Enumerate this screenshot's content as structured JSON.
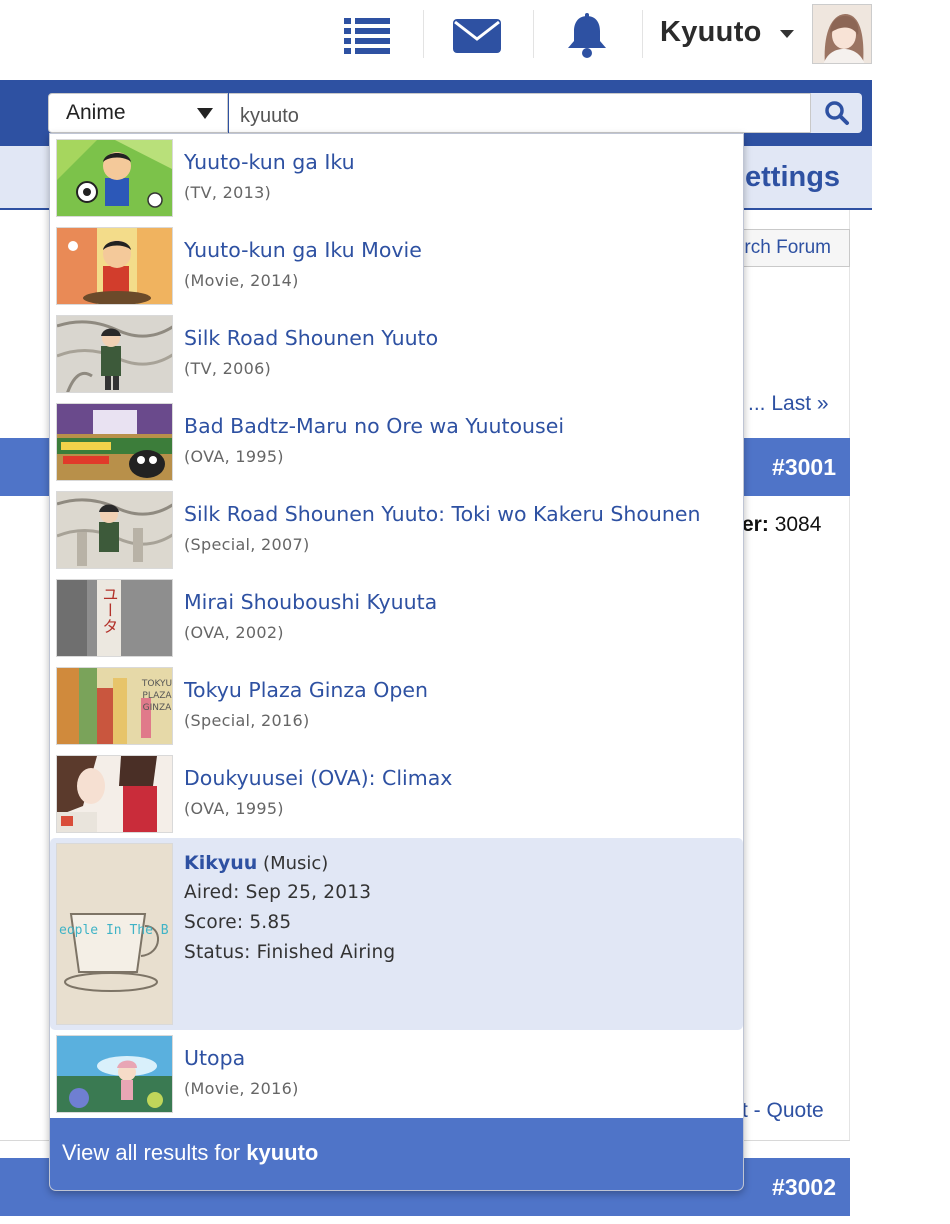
{
  "header": {
    "username": "Kyuuto",
    "icons": {
      "list": "list-icon",
      "mail": "mail-icon",
      "bell": "bell-icon"
    }
  },
  "search": {
    "type_value": "Anime",
    "query": "kyuuto"
  },
  "background": {
    "settings_label": "ettings",
    "search_forum_label": "rch Forum",
    "pager_text": "... Last »",
    "post1_number": "#3001",
    "post2_number": "#3002",
    "member_label": "er:",
    "member_value": "3084",
    "quote_prefix": "t -",
    "quote_label": "Quote"
  },
  "results": [
    {
      "title": "Yuuto-kun ga Iku",
      "meta": "(TV, 2013)"
    },
    {
      "title": "Yuuto-kun ga Iku Movie",
      "meta": "(Movie, 2014)"
    },
    {
      "title": "Silk Road Shounen Yuuto",
      "meta": "(TV, 2006)"
    },
    {
      "title": "Bad Badtz-Maru no Ore wa Yuutousei",
      "meta": "(OVA, 1995)"
    },
    {
      "title": "Silk Road Shounen Yuuto: Toki wo Kakeru Shounen",
      "meta": "(Special, 2007)"
    },
    {
      "title": "Mirai Shouboushi Kyuuta",
      "meta": "(OVA, 2002)"
    },
    {
      "title": "Tokyu Plaza Ginza Open",
      "meta": "(Special, 2016)"
    },
    {
      "title": "Doukyuusei (OVA): Climax",
      "meta": "(OVA, 1995)"
    }
  ],
  "expanded": {
    "title": "Kikyuu",
    "type": "(Music)",
    "aired": "Aired: Sep 25, 2013",
    "score": "Score: 5.85",
    "status": "Status: Finished Airing",
    "thumb_text": "eople In The B"
  },
  "last_result": {
    "title": "Utopa",
    "meta": "(Movie, 2016)"
  },
  "thumb_texts": {
    "result_6_label": "ユータ",
    "result_7_label_1": "TOKYU",
    "result_7_label_2": "PLAZA",
    "result_7_label_3": "GINZA"
  },
  "view_all": {
    "prefix": "View all results for",
    "query": "kyuuto"
  },
  "colors": {
    "brand_blue": "#2e51a2",
    "highlight": "#e1e7f5",
    "footer_blue": "#4f74c8"
  }
}
